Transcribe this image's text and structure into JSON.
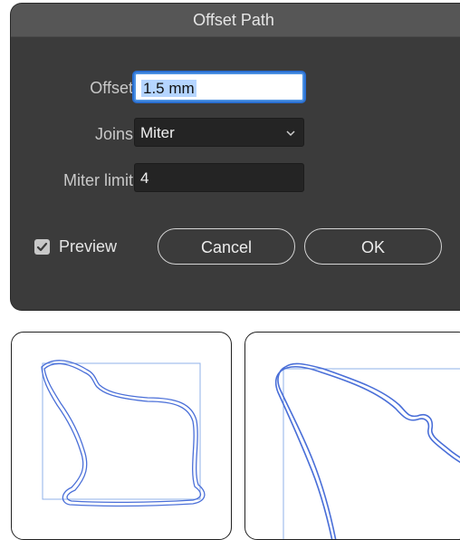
{
  "dialog": {
    "title": "Offset Path",
    "offset": {
      "label": "Offset:",
      "value": "1.5 mm"
    },
    "joins": {
      "label": "Joins:",
      "value": "Miter"
    },
    "miter_limit": {
      "label": "Miter limit:",
      "value": "4"
    },
    "preview": {
      "label": "Preview",
      "checked": true
    },
    "cancel_label": "Cancel",
    "ok_label": "OK"
  },
  "colors": {
    "dialog_bg": "#3b3b3b",
    "titlebar_bg": "#565656",
    "focus_ring": "#2a6fd1",
    "path_blue": "#4a6fd8"
  },
  "icons": {
    "dropdown": "chevron-down-icon",
    "checkbox": "checkmark-icon"
  }
}
